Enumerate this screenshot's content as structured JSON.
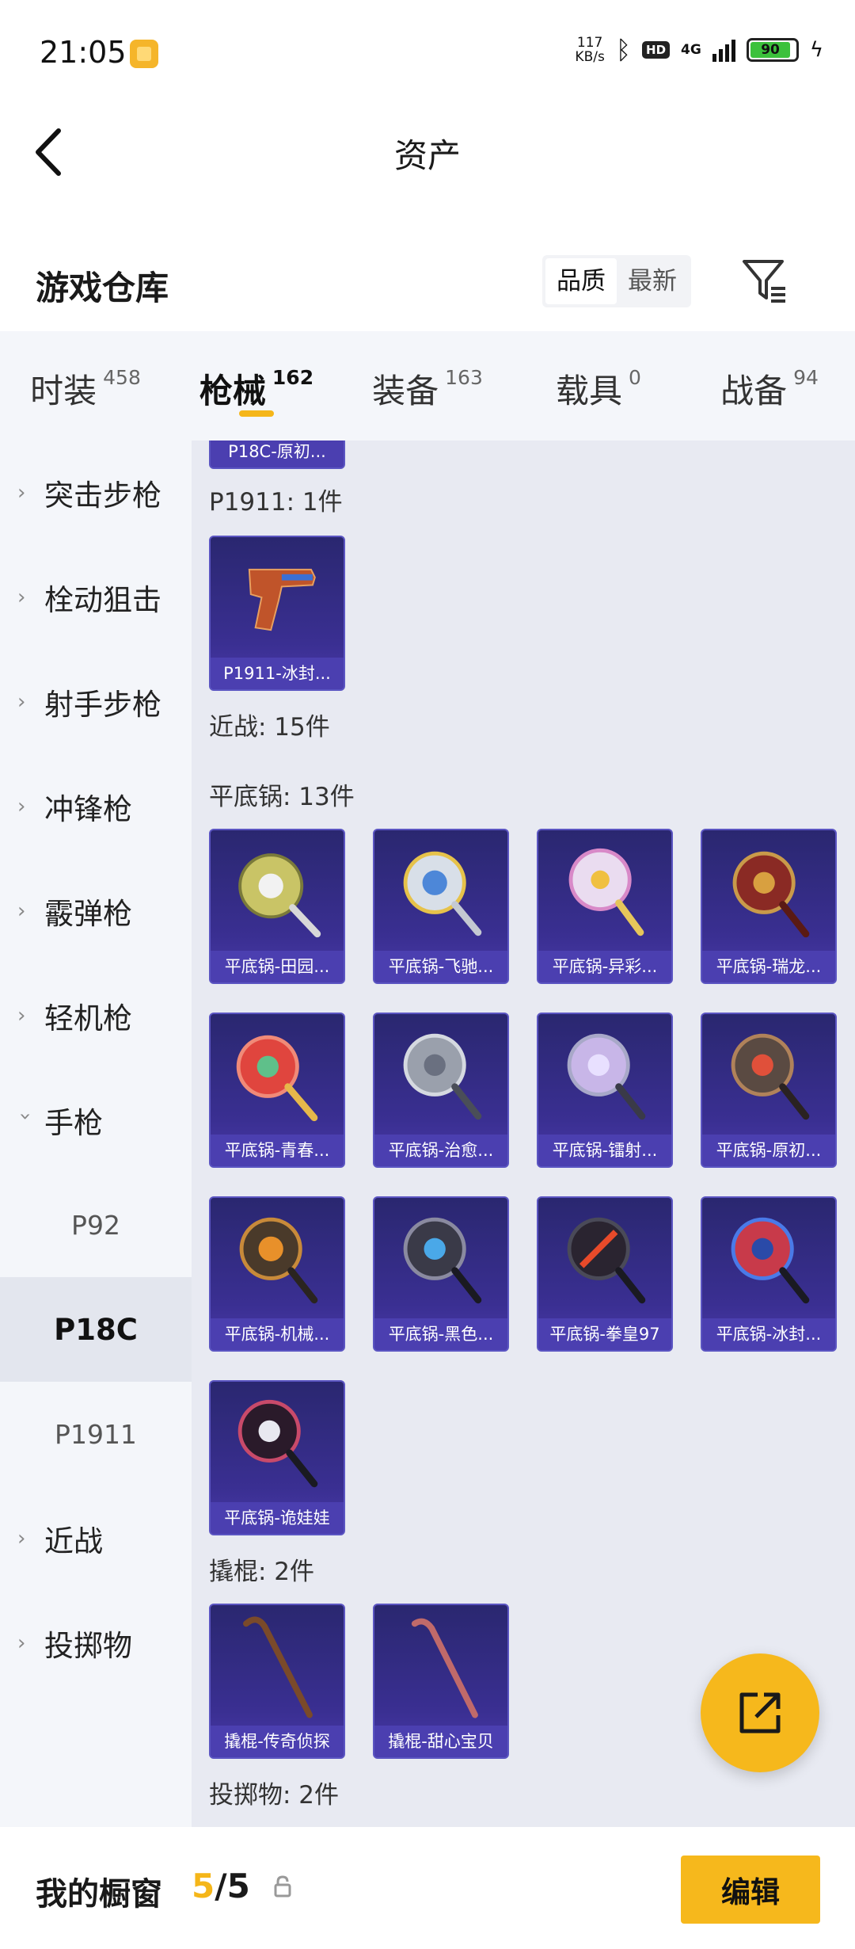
{
  "status_bar": {
    "time": "21:05",
    "speed_value": "117",
    "speed_unit": "KB/s",
    "hd": "HD",
    "network": "4G",
    "battery": "90",
    "icons": [
      "app-notification-icon",
      "bluetooth-icon",
      "signal-icon",
      "battery-icon",
      "charging-icon"
    ]
  },
  "header": {
    "title": "资产",
    "back_icon": "back-arrow-icon"
  },
  "section": {
    "title": "游戏仓库",
    "sort_options": [
      "品质",
      "最新"
    ],
    "active_sort": "品质",
    "filter_icon": "filter-icon"
  },
  "tabs": [
    {
      "label": "时装",
      "count": "458"
    },
    {
      "label": "枪械",
      "count": "162"
    },
    {
      "label": "装备",
      "count": "163"
    },
    {
      "label": "载具",
      "count": "0"
    },
    {
      "label": "战备",
      "count": "94"
    }
  ],
  "active_tab": "枪械",
  "sidebar": {
    "items": [
      "突击步枪",
      "栓动狙击",
      "射手步枪",
      "冲锋枪",
      "霰弹枪",
      "轻机枪",
      "手枪"
    ],
    "pistol_subitems": [
      "P92",
      "P18C",
      "P1911"
    ],
    "active_subitem": "P18C",
    "items_after": [
      "近战",
      "投掷物"
    ]
  },
  "content": {
    "partial_card_caption": "P18C-原初...",
    "groups": [
      {
        "label": "P1911: 1件",
        "items": [
          "P1911-冰封..."
        ]
      },
      {
        "label": "近战: 15件",
        "items": []
      },
      {
        "label": "平底锅: 13件",
        "items": [
          "平底锅-田园...",
          "平底锅-飞驰...",
          "平底锅-异彩...",
          "平底锅-瑞龙...",
          "平底锅-青春...",
          "平底锅-治愈...",
          "平底锅-镭射...",
          "平底锅-原初...",
          "平底锅-机械...",
          "平底锅-黑色...",
          "平底锅-拳皇97",
          "平底锅-冰封...",
          "平底锅-诡娃娃"
        ]
      },
      {
        "label": "撬棍: 2件",
        "items": [
          "撬棍-传奇侦探",
          "撬棍-甜心宝贝"
        ]
      },
      {
        "label": "投掷物: 2件",
        "items": []
      }
    ]
  },
  "fab": {
    "icon": "share-external-icon"
  },
  "bottom_bar": {
    "title": "我的橱窗",
    "count_current": "5",
    "count_total": "/5",
    "lock_icon": "lock-icon",
    "edit_label": "编辑"
  },
  "colors": {
    "accent": "#f6b81c",
    "card_bg": "#3a2f92",
    "card_caption_bg": "#4b3fb0",
    "content_bg": "#e8eaf2",
    "sidebar_bg": "#f4f6fa"
  }
}
